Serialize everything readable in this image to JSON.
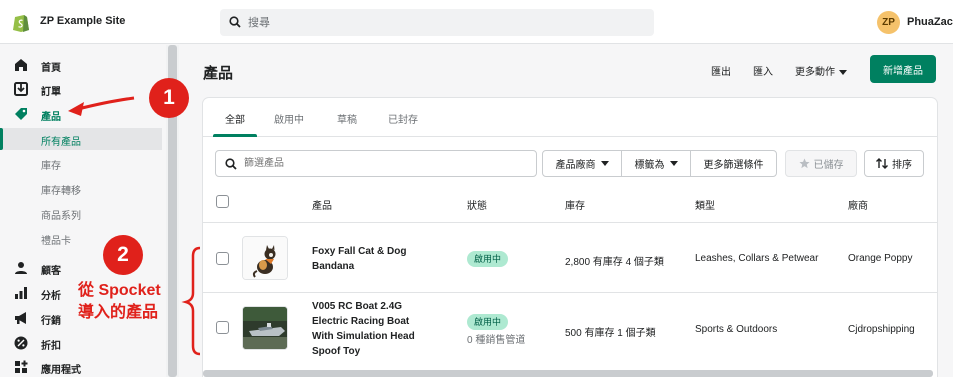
{
  "topbar": {
    "site_name": "ZP Example Site",
    "search_placeholder": "搜尋",
    "avatar_initials": "ZP",
    "username": "PhuaZac"
  },
  "sidebar": {
    "items": [
      {
        "label": "首頁",
        "icon": "home-icon"
      },
      {
        "label": "訂單",
        "icon": "orders-icon"
      },
      {
        "label": "產品",
        "icon": "tag-icon"
      }
    ],
    "sub_items": [
      {
        "label": "所有產品"
      },
      {
        "label": "庫存"
      },
      {
        "label": "庫存轉移"
      },
      {
        "label": "商品系列"
      },
      {
        "label": "禮品卡"
      }
    ],
    "items_bottom": [
      {
        "label": "顧客",
        "icon": "person-icon"
      },
      {
        "label": "分析",
        "icon": "bar-chart-icon"
      },
      {
        "label": "行銷",
        "icon": "megaphone-icon"
      },
      {
        "label": "折扣",
        "icon": "discount-icon"
      },
      {
        "label": "應用程式",
        "icon": "apps-icon"
      }
    ]
  },
  "main": {
    "title": "產品",
    "export_label": "匯出",
    "import_label": "匯入",
    "more_actions_label": "更多動作",
    "add_product_label": "新增產品",
    "tabs": [
      {
        "label": "全部"
      },
      {
        "label": "啟用中"
      },
      {
        "label": "草稿"
      },
      {
        "label": "已封存"
      }
    ],
    "filter_placeholder": "篩選產品",
    "filters": {
      "vendor": "產品廠商",
      "tagged": "標籤為",
      "more": "更多篩選條件",
      "saved": "已儲存",
      "sort": "排序"
    },
    "columns": {
      "product": "產品",
      "status": "狀態",
      "inventory": "庫存",
      "type": "類型",
      "vendor": "廠商"
    },
    "rows": [
      {
        "name": "Foxy Fall Cat & Dog Bandana",
        "status": "啟用中",
        "status_note": "",
        "inventory": "2,800 有庫存 4 個子類",
        "type": "Leashes, Collars & Petwear",
        "vendor": "Orange Poppy"
      },
      {
        "name": "V005 RC Boat 2.4G Electric Racing Boat With Simulation Head Spoof Toy",
        "status": "啟用中",
        "status_note": "0 種銷售管道",
        "inventory": "500 有庫存 1 個子類",
        "type": "Sports & Outdoors",
        "vendor": "Cjdropshipping"
      }
    ]
  },
  "annotations": {
    "step1": "1",
    "step2": "2",
    "caption_line1": "從 Spocket",
    "caption_line2": "導入的產品"
  },
  "colors": {
    "accent": "#008060",
    "annotation": "#e0211b",
    "badge_bg": "#aee9d1"
  }
}
